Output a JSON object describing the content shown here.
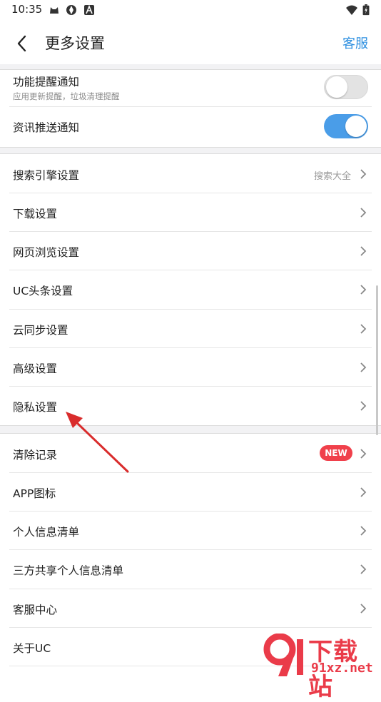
{
  "status_bar": {
    "time": "10:35",
    "left_icons": [
      "cat-app-icon",
      "aperture-icon",
      "a-app-icon"
    ],
    "right_icons": [
      "wifi-icon",
      "battery-icon"
    ]
  },
  "header": {
    "title": "更多设置",
    "service_link": "客服"
  },
  "notifications": {
    "feature_reminder": {
      "label": "功能提醒通知",
      "sub": "应用更新提醒，垃圾清理提醒",
      "enabled": false
    },
    "news_push": {
      "label": "资讯推送通知",
      "enabled": true
    }
  },
  "settings_group": [
    {
      "label": "搜索引擎设置",
      "value": "搜索大全"
    },
    {
      "label": "下载设置"
    },
    {
      "label": "网页浏览设置"
    },
    {
      "label": "UC头条设置"
    },
    {
      "label": "云同步设置"
    },
    {
      "label": "高级设置"
    },
    {
      "label": "隐私设置"
    }
  ],
  "info_group": [
    {
      "label": "清除记录",
      "badge": "NEW"
    },
    {
      "label": "APP图标"
    },
    {
      "label": "个人信息清单"
    },
    {
      "label": "三方共享个人信息清单"
    },
    {
      "label": "客服中心"
    },
    {
      "label": "关于UC"
    }
  ],
  "watermark": {
    "name": "下载站",
    "url": "91xz.net"
  },
  "colors": {
    "accent": "#2d8fe0",
    "toggle_on": "#4a9de8",
    "badge": "#f0404b",
    "annotation_arrow": "#d92c2c"
  }
}
